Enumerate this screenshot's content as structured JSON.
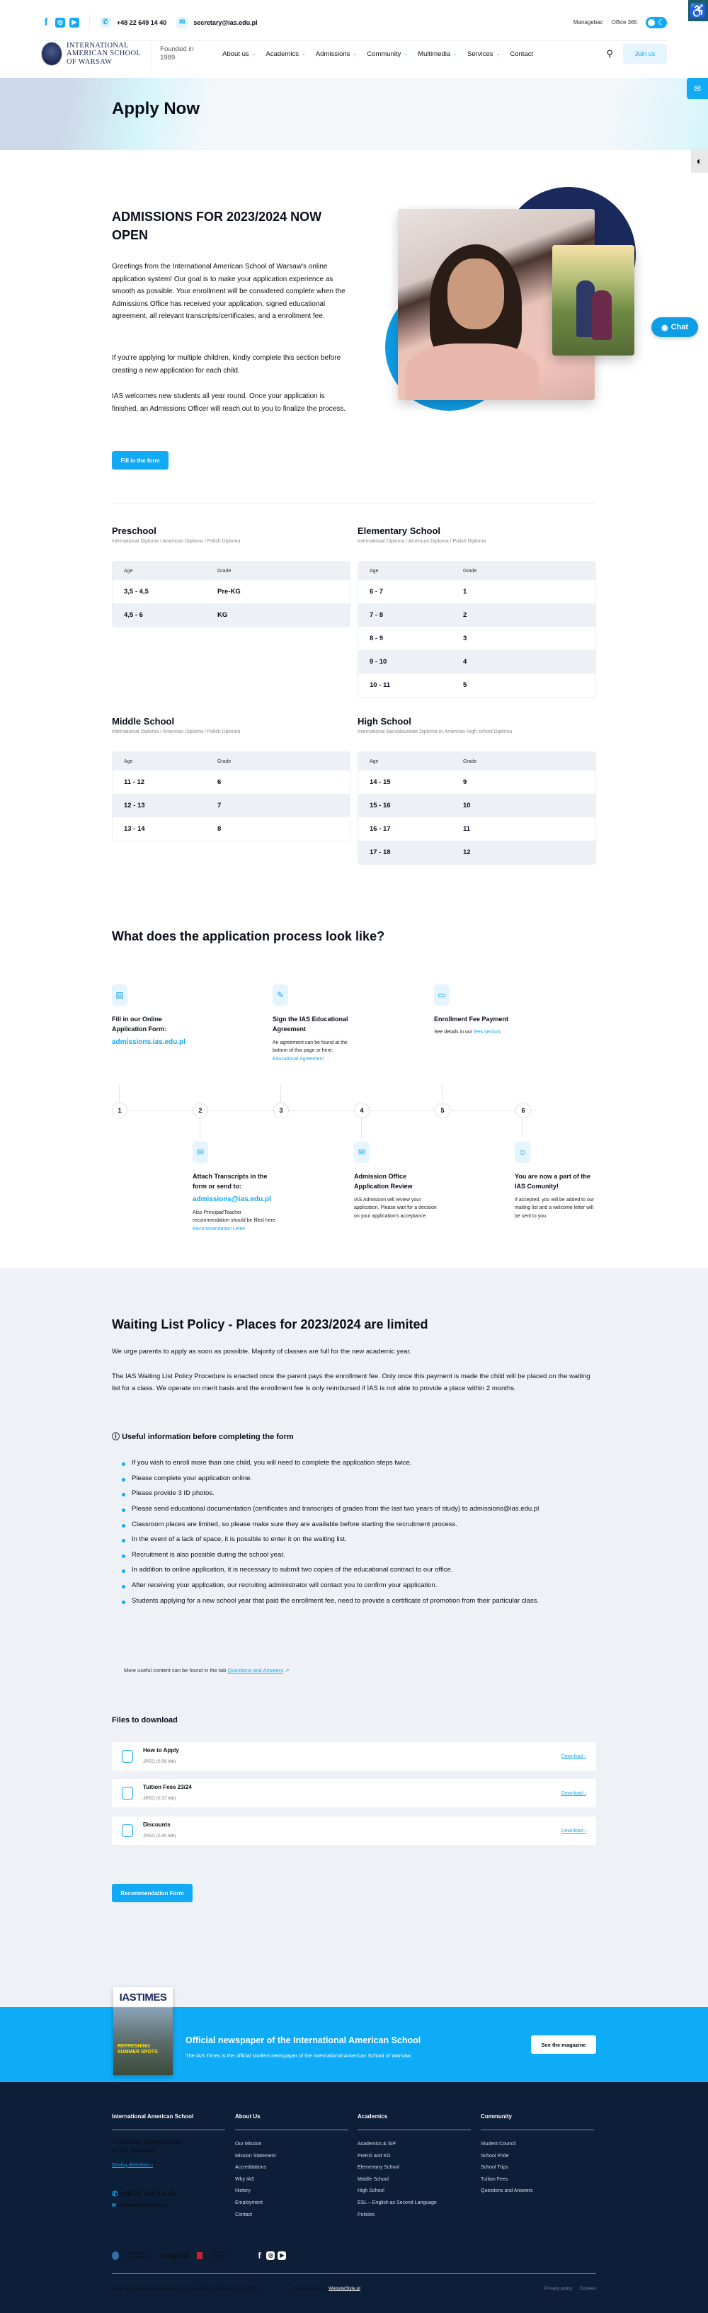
{
  "topbar": {
    "social": [
      "facebook",
      "instagram",
      "youtube"
    ],
    "phone": "+48 22 649 14 40",
    "email": "secretary@ias.edu.pl",
    "links": [
      "Managebac",
      "Office 365"
    ]
  },
  "nav": {
    "logo_lines": [
      "International",
      "American School",
      "Of Warsaw"
    ],
    "founded": "Founded in 1989",
    "menu": [
      {
        "label": "About us",
        "dropdown": true
      },
      {
        "label": "Academics",
        "dropdown": true
      },
      {
        "label": "Admissions",
        "dropdown": true
      },
      {
        "label": "Community",
        "dropdown": true
      },
      {
        "label": "Multimedia",
        "dropdown": true
      },
      {
        "label": "Services",
        "dropdown": true
      },
      {
        "label": "Contact",
        "dropdown": false
      }
    ],
    "join_label": "Join us"
  },
  "widgets": {
    "chat_label": "Chat"
  },
  "hero": {
    "title": "Apply Now"
  },
  "admissions": {
    "title": "ADMISSIONS FOR 2023/2024 NOW OPEN",
    "paragraphs": [
      "Greetings from the International American School of Warsaw's online application system! Our goal is to make your application experience as smooth as possible. Your enrollment will be considered complete when the Admissions Office has received your application, signed educational agreement, all relevant transcripts/certificates, and a enrollment fee.",
      "If you're applying for multiple children, kindly complete this section before creating a new application for each child.",
      "IAS welcomes new students all year round. Once your application is finished, an Admissions Officer will reach out to you to finalize the process."
    ],
    "button": "Fill in the form"
  },
  "grade_tables": [
    {
      "title": "Preschool",
      "subtitle": "International Diploma / American Diploma / Polish Diploma",
      "headers": [
        "Age",
        "Grade"
      ],
      "rows": [
        [
          "3,5 - 4,5",
          "Pre-KG"
        ],
        [
          "4,5 - 6",
          "KG"
        ]
      ]
    },
    {
      "title": "Elementary School",
      "subtitle": "International Diploma / American Diploma / Polish Diploma",
      "headers": [
        "Age",
        "Grade"
      ],
      "rows": [
        [
          "6 - 7",
          "1"
        ],
        [
          "7 - 8",
          "2"
        ],
        [
          "8 - 9",
          "3"
        ],
        [
          "9 - 10",
          "4"
        ],
        [
          "10 - 11",
          "5"
        ]
      ]
    },
    {
      "title": "Middle School",
      "subtitle": "International Diploma / American Diploma / Polish Diploma",
      "headers": [
        "Age",
        "Grade"
      ],
      "rows": [
        [
          "11 - 12",
          "6"
        ],
        [
          "12 - 13",
          "7"
        ],
        [
          "13 - 14",
          "8"
        ]
      ]
    },
    {
      "title": "High School",
      "subtitle": "International Baccalaureate Diploma or American High school Diploma",
      "headers": [
        "Age",
        "Grade"
      ],
      "rows": [
        [
          "14 - 15",
          "9"
        ],
        [
          "15 - 16",
          "10"
        ],
        [
          "16 - 17",
          "11"
        ],
        [
          "17 - 18",
          "12"
        ]
      ]
    }
  ],
  "process": {
    "title": "What does the application process look like?",
    "steps": [
      {
        "num": "1",
        "icon": "document-icon",
        "title": "Fill in our Online Application Form:",
        "link": "admissions.ias.edu.pl",
        "text": ""
      },
      {
        "num": "2",
        "icon": "mail-send-icon",
        "title": "Attach Transcripts in the form or send to:",
        "link": "admissions@ias.edu.pl",
        "text": "Also Principal/Teacher recommendation should be filled here:",
        "text_link": "Recommendation Letter"
      },
      {
        "num": "3",
        "icon": "pen-icon",
        "title": "Sign the IAS Educational Agreement",
        "link": "",
        "text": "An agreement can be found at the bottom of this page or here:",
        "text_link": "Educational Agreement"
      },
      {
        "num": "4",
        "icon": "mail-check-icon",
        "title": "Admission Office Application Review",
        "link": "",
        "text": "IAS Admission will review your application. Please wait for a decision on your application's acceptance."
      },
      {
        "num": "5",
        "icon": "card-icon",
        "title": "Enrollment Fee Payment",
        "link": "",
        "text": "See details in our",
        "text_link": "fees section"
      },
      {
        "num": "6",
        "icon": "smile-icon",
        "title": "You are now a part of the IAS Comunity!",
        "link": "",
        "text": "If accepted, you will be added to our mailing list and a welcome letter will be sent to you."
      }
    ]
  },
  "waiting": {
    "title": "Waiting List Policy - Places for 2023/2024 are limited",
    "p1": "We urge parents to apply as soon as possible. Majority of classes are full for the new academic year.",
    "p2": "The IAS Waiting List Policy Procedure is enacted once the parent pays the enrollment fee. Only once this payment is made the child will be placed on the waiting list for a class. We operate on merit basis and the enrollment fee is only reimbursed if IAS is not able to provide a place within 2 months.",
    "info_title": "Useful information before completing the form",
    "items": [
      "If you wish to enroll more than one child, you will need to complete the application steps twice.",
      "Please complete your application online.",
      "Please provide 3 ID photos.",
      "Please send educational documentation (certificates and transcripts of grades from the last two years of study) to admissions@ias.edu.pl",
      "Classroom places are limited, so please make sure they are available before starting the recruitment process.",
      "In the event of a lack of space, it is possible to enter it on the waiting list.",
      "Recruitment is also possible during the school year.",
      "In addition to online application, it is necessary to submit two copies of the educational contract to our office.",
      "After receiving your application, our recruiting administrator will contact you to confirm your application.",
      "Students applying for a new school year that paid the enrollment fee, need to provide a certificate of promotion from their particular class."
    ],
    "more_text": "More useful content can be found in the tab",
    "more_link": "Questions and Answers"
  },
  "files": {
    "title": "Files to download",
    "items": [
      {
        "name": "How to Apply",
        "meta": "JPEG (0.56 Mb)",
        "action": "Download"
      },
      {
        "name": "Tuition Fees 23/24",
        "meta": "JPEG (0.37 Mb)",
        "action": "Download"
      },
      {
        "name": "Discounts",
        "meta": "JPEG (0.40 Mb)",
        "action": "Download"
      }
    ],
    "button": "Recommendation Form"
  },
  "newspaper": {
    "cover_title": "IASTIMES",
    "cover_headline": "REFRESHING SUMMER SPOTS",
    "title": "Official newspaper of the International American School",
    "text": "The IAS Times is the official student newspaper of the International American School of Warsaw.",
    "button": "See the magazine"
  },
  "footer": {
    "col1": {
      "title": "International American School",
      "address": [
        "ul. Dembego 18, Metro Kabaty",
        "02-796, Warszawa"
      ],
      "directions": "Driving directions",
      "phone": "+48 22 649 14 40",
      "email": "secretary@ias.edu.pl"
    },
    "col2": {
      "title": "About Us",
      "items": [
        "Our Mission",
        "Mission Statement",
        "Accreditations",
        "Why IAS",
        "History",
        "Employment",
        "Contact"
      ]
    },
    "col3": {
      "title": "Academics",
      "items": [
        "Academics & SIP",
        "PreKG and KG",
        "Elementary School",
        "Middle School",
        "High School",
        "ESL – English as Second Language",
        "Policies"
      ]
    },
    "col4": {
      "title": "Community",
      "items": [
        "Student Council",
        "School Pride",
        "School Trips",
        "Tuition Fees",
        "Questions and Answers"
      ]
    },
    "brands": [
      "International Baccalaureate",
      "cognia",
      "Ministerstwo Edukacji Narodowej"
    ],
    "copyright": "Copyright International American School. All Right Reserved 2022-2023.",
    "website_text": "Website pages –",
    "website_link": "WebsiteStyle.pl",
    "legal": [
      "Privacy policy",
      "Cookies"
    ]
  }
}
